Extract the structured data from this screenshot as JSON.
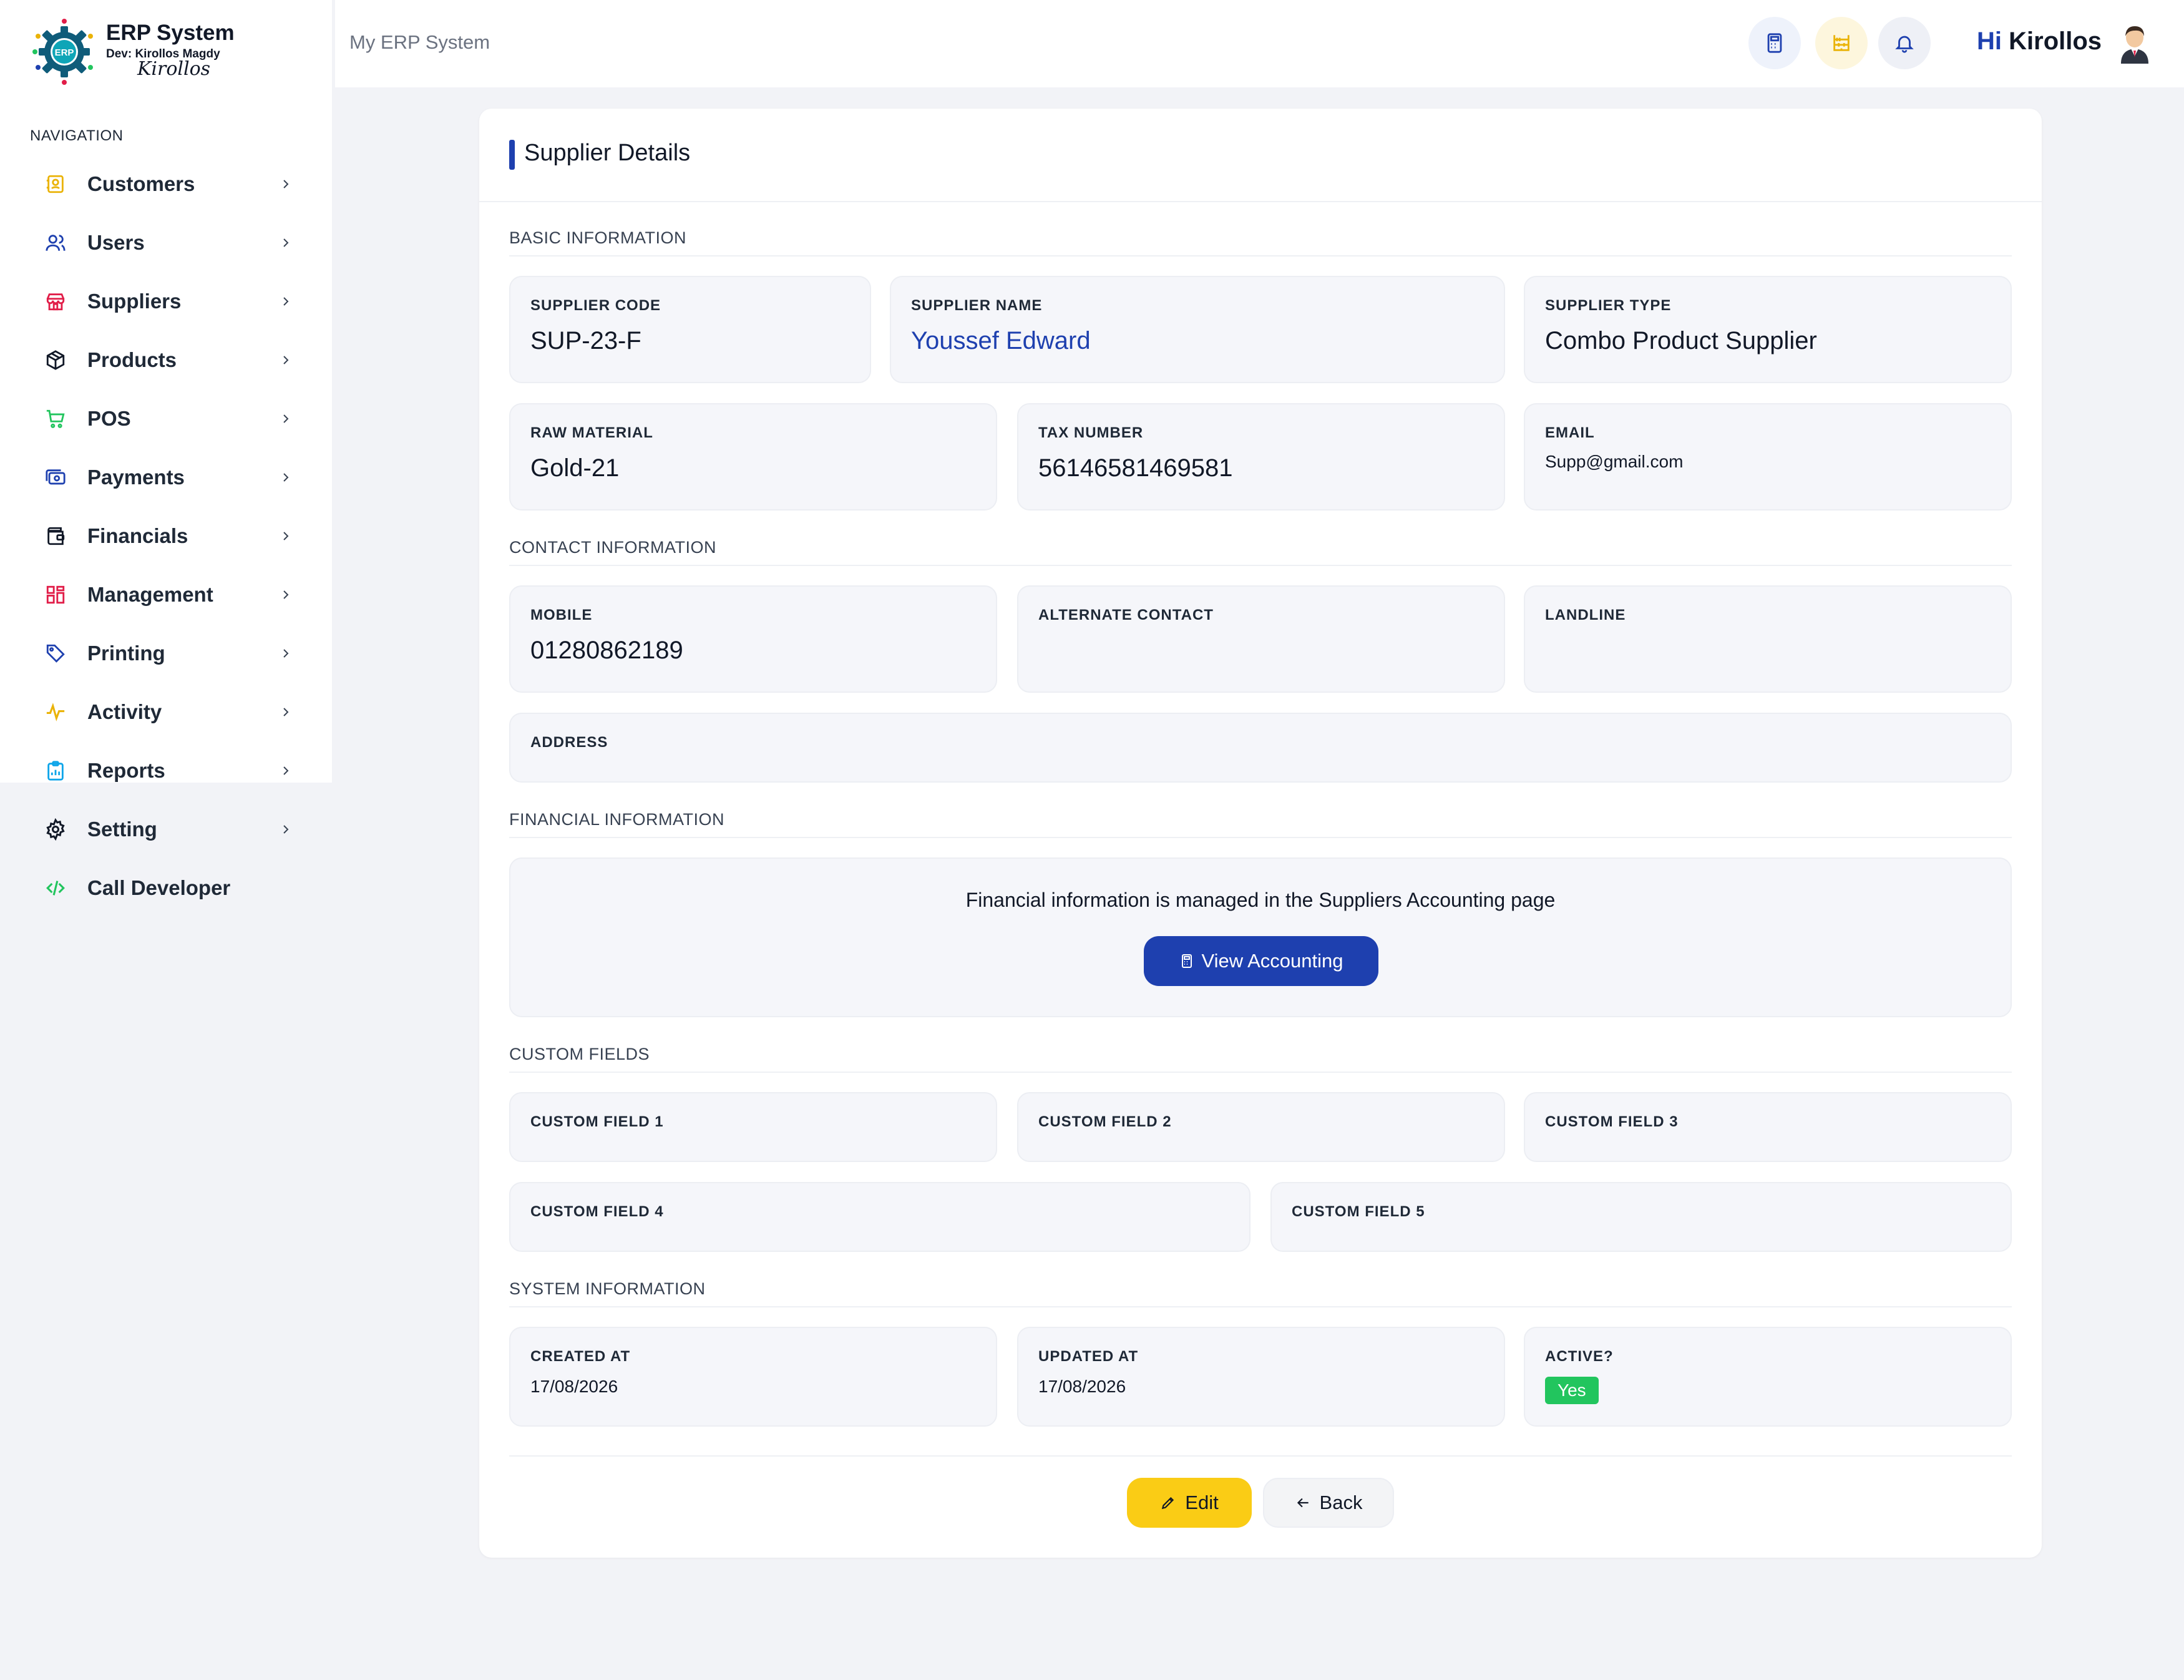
{
  "brand": {
    "title": "ERP System",
    "dev": "Dev: Kirollos Magdy",
    "signature": "Kirollos",
    "logo_text": "ERP"
  },
  "sidebar": {
    "heading": "NAVIGATION",
    "items": [
      {
        "label": "Customers",
        "icon": "address-book-icon",
        "color": "#eab308"
      },
      {
        "label": "Users",
        "icon": "users-icon",
        "color": "#1e40af"
      },
      {
        "label": "Suppliers",
        "icon": "store-icon",
        "color": "#e11d48"
      },
      {
        "label": "Products",
        "icon": "box-icon",
        "color": "#111827"
      },
      {
        "label": "POS",
        "icon": "cart-icon",
        "color": "#22c55e"
      },
      {
        "label": "Payments",
        "icon": "payment-icon",
        "color": "#1e40af"
      },
      {
        "label": "Financials",
        "icon": "wallet-icon",
        "color": "#111827"
      },
      {
        "label": "Management",
        "icon": "grid-icon",
        "color": "#e11d48"
      },
      {
        "label": "Printing",
        "icon": "tag-icon",
        "color": "#1e40af"
      },
      {
        "label": "Activity",
        "icon": "pulse-icon",
        "color": "#eab308"
      },
      {
        "label": "Reports",
        "icon": "report-icon",
        "color": "#0ea5e9"
      },
      {
        "label": "Setting",
        "icon": "gear-icon",
        "color": "#111827"
      },
      {
        "label": "Call Developer",
        "icon": "code-icon",
        "color": "#22c55e"
      }
    ]
  },
  "header": {
    "title": "My ERP System",
    "greeting_hi": "Hi",
    "greeting_name": "Kirollos"
  },
  "card": {
    "title": "Supplier Details",
    "sections": {
      "basic": "BASIC INFORMATION",
      "contact": "CONTACT INFORMATION",
      "financial": "FINANCIAL INFORMATION",
      "custom": "CUSTOM FIELDS",
      "system": "SYSTEM INFORMATION"
    },
    "fields": {
      "supplier_code": {
        "label": "SUPPLIER CODE",
        "value": "SUP-23-F"
      },
      "supplier_name": {
        "label": "SUPPLIER NAME",
        "value": "Youssef Edward"
      },
      "supplier_type": {
        "label": "SUPPLIER TYPE",
        "value": "Combo Product Supplier"
      },
      "raw_material": {
        "label": "RAW MATERIAL",
        "value": "Gold-21"
      },
      "tax_number": {
        "label": "TAX NUMBER",
        "value": "56146581469581"
      },
      "email": {
        "label": "EMAIL",
        "value": "Supp@gmail.com"
      },
      "mobile": {
        "label": "MOBILE",
        "value": "01280862189"
      },
      "alternate_contact": {
        "label": "ALTERNATE CONTACT",
        "value": ""
      },
      "landline": {
        "label": "LANDLINE",
        "value": ""
      },
      "address": {
        "label": "ADDRESS",
        "value": ""
      },
      "custom_1": {
        "label": "CUSTOM FIELD 1",
        "value": ""
      },
      "custom_2": {
        "label": "CUSTOM FIELD 2",
        "value": ""
      },
      "custom_3": {
        "label": "CUSTOM FIELD 3",
        "value": ""
      },
      "custom_4": {
        "label": "CUSTOM FIELD 4",
        "value": ""
      },
      "custom_5": {
        "label": "CUSTOM FIELD 5",
        "value": ""
      },
      "created_at": {
        "label": "CREATED AT",
        "value": "17/08/2026"
      },
      "updated_at": {
        "label": "UPDATED AT",
        "value": "17/08/2026"
      },
      "active": {
        "label": "ACTIVE?",
        "value": "Yes"
      }
    },
    "financial_note": "Financial information is managed in the Suppliers Accounting page",
    "view_accounting_label": "View Accounting",
    "edit_label": "Edit",
    "back_label": "Back"
  },
  "colors": {
    "primary": "#1e40af",
    "accent_yellow": "#facc15",
    "active_green": "#22c55e"
  }
}
